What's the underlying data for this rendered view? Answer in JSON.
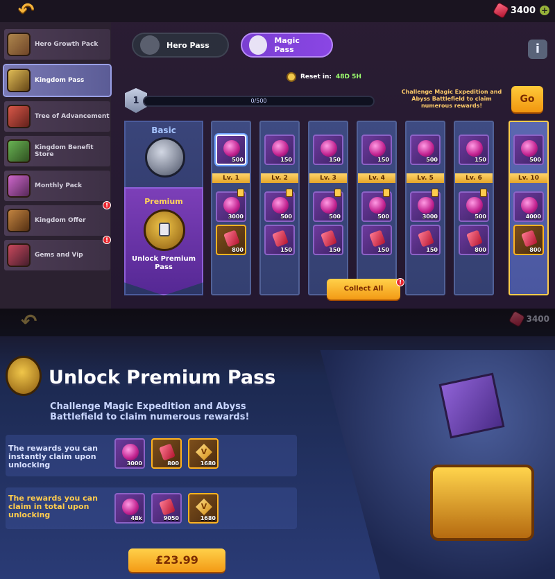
{
  "header": {
    "gem_count": "3400"
  },
  "sidebar": {
    "items": [
      {
        "label": "Hero Growth Pack",
        "badge": ""
      },
      {
        "label": "Kingdom Pass",
        "badge": ""
      },
      {
        "label": "Tree of Advancement",
        "badge": ""
      },
      {
        "label": "Kingdom Benefit Store",
        "badge": ""
      },
      {
        "label": "Monthly Pack",
        "badge": ""
      },
      {
        "label": "Kingdom Offer",
        "badge": "!"
      },
      {
        "label": "Gems and Vip",
        "badge": "!"
      }
    ]
  },
  "tabs": [
    {
      "label": "Hero Pass",
      "active": false
    },
    {
      "label": "Magic Pass",
      "active": true
    }
  ],
  "reset": {
    "label": "Reset in:",
    "time": "48D 5H"
  },
  "level": {
    "current": "1",
    "progress_text": "0/500"
  },
  "challenge": {
    "text": "Challenge Magic Expedition and Abyss Battlefield to claim numerous rewards!",
    "go": "Go"
  },
  "basic": {
    "label": "Basic"
  },
  "premium": {
    "label": "Premium",
    "unlock_label": "Unlock Premium Pass"
  },
  "levels": [
    {
      "lv": "Lv. 1",
      "basic_amt": "500",
      "prem_orb": "3000",
      "prem_gem": "800"
    },
    {
      "lv": "Lv. 2",
      "basic_amt": "150",
      "prem_orb": "500",
      "prem_gem": "150"
    },
    {
      "lv": "Lv. 3",
      "basic_amt": "150",
      "prem_orb": "500",
      "prem_gem": "150"
    },
    {
      "lv": "Lv. 4",
      "basic_amt": "150",
      "prem_orb": "500",
      "prem_gem": "150"
    },
    {
      "lv": "Lv. 5",
      "basic_amt": "500",
      "prem_orb": "3000",
      "prem_gem": "150"
    },
    {
      "lv": "Lv. 6",
      "basic_amt": "150",
      "prem_orb": "500",
      "prem_gem": "800"
    },
    {
      "lv": "Lv. 10",
      "basic_amt": "500",
      "prem_orb": "4000",
      "prem_gem": "800"
    }
  ],
  "collect_all": "Collect All",
  "popup": {
    "gem_count": "3400",
    "title": "Unlock Premium Pass",
    "subtitle": "Challenge Magic Expedition and Abyss Battlefield to claim numerous rewards!",
    "instant_label": "The rewards you can instantly claim upon unlocking",
    "instant_rewards": [
      "3000",
      "800",
      "1680"
    ],
    "total_label": "The rewards you can claim in total upon unlocking",
    "total_rewards": [
      "48k",
      "9050",
      "1680"
    ],
    "price": "£23.99"
  }
}
